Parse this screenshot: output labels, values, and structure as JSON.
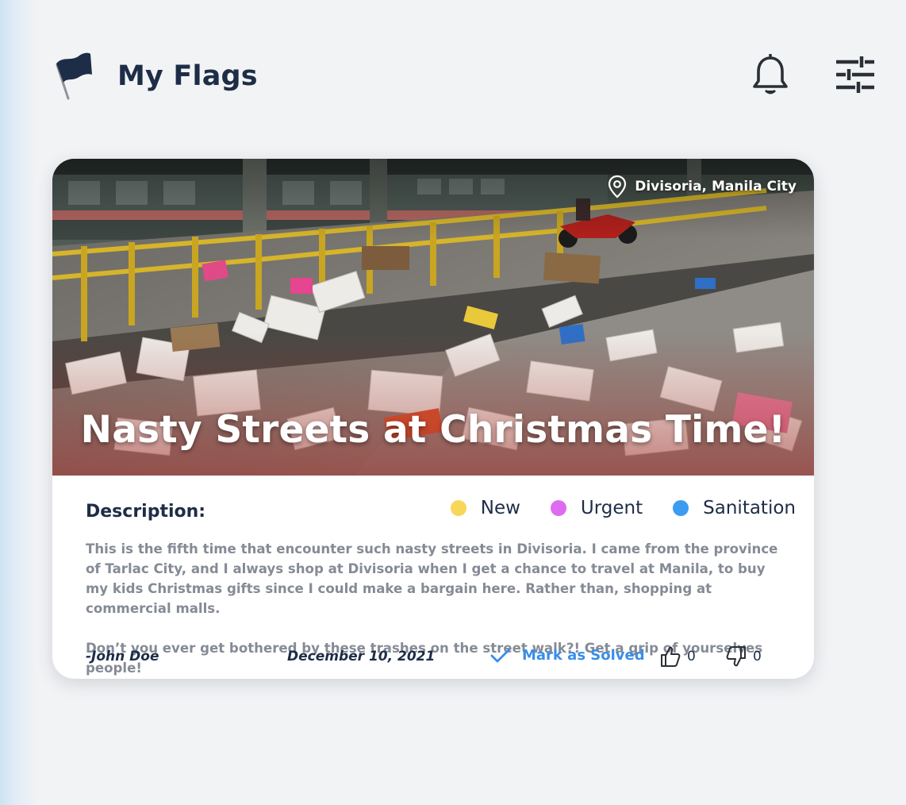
{
  "header": {
    "title": "My Flags",
    "icons": [
      "flag-icon",
      "bell-icon",
      "sliders-icon"
    ]
  },
  "card": {
    "location": "Divisoria, Manila City",
    "title": "Nasty Streets at Christmas Time!",
    "description_label": "Description:",
    "tags": [
      {
        "label": "New",
        "color": "#f7d65a"
      },
      {
        "label": "Urgent",
        "color": "#de6cf0"
      },
      {
        "label": "Sanitation",
        "color": "#3b9cf2"
      }
    ],
    "description": [
      "This is the fifth time that encounter such nasty streets in Divisoria. I came from the province of Tarlac City, and I always shop at Divisoria when I get a chance to travel at Manila, to buy my kids Christmas gifts since I could make a bargain here. Rather than, shopping at commercial malls.",
      "Don’t you ever get bothered by these trashes on the street walk?!  Get a grip of yourselves people!"
    ],
    "author": "-John Doe",
    "date": "December 10, 2021",
    "mark_solved_label": "Mark as Solved",
    "likes": "0",
    "dislikes": "0"
  },
  "colors": {
    "accent": "#3a8ee6",
    "heading": "#1e2d47",
    "body_text": "#858b95"
  }
}
